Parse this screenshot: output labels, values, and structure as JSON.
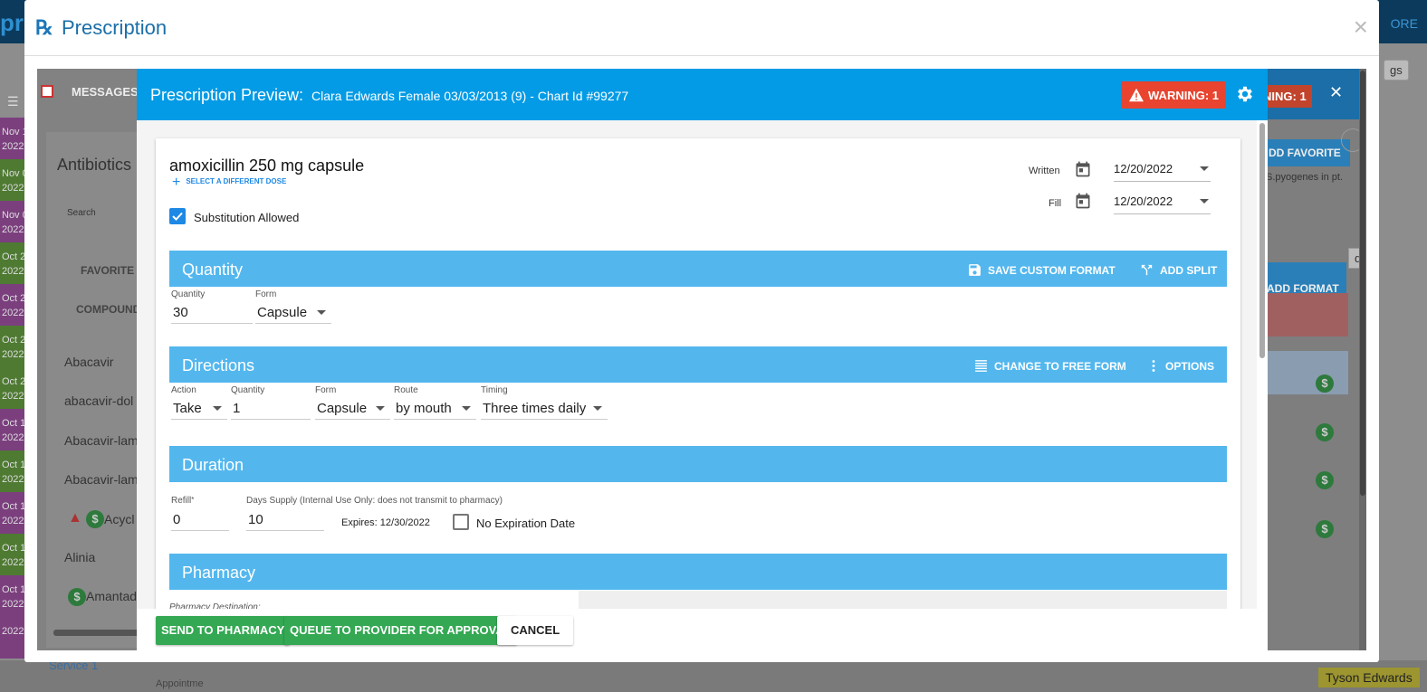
{
  "background": {
    "logo": "pr",
    "more": "ORE",
    "messages": "MESSAGES",
    "antibiotics": "Antibiotics",
    "search": "Search",
    "favorite": "FAVORITE",
    "compound": "COMPOUND",
    "items": [
      "Abacavir",
      "abacavir-dol",
      "Abacavir-lam",
      "Abacavir-lam",
      "Acycl",
      "Alinia",
      "Amantad"
    ],
    "dates": [
      "Nov 1 2022",
      "Nov 0 2022",
      "Nov 0 2022",
      "Oct 2 2022",
      "Oct 2 2022",
      "Oct 2 2022",
      "Oct 2 2022",
      "Oct 1 2022",
      "Oct 1 2022",
      "Oct 1 2022",
      "Oct 1 2022",
      "Oct 1 2022",
      "2022"
    ],
    "warning": "NING: 1",
    "add_favorite": "DD FAVORITE",
    "pyogenes": "S.pyogenes in pt.",
    "add_format": "ADD FORMAT",
    "ngs": "gs",
    "d": "d",
    "service": "Service 1",
    "appointment": "Appointme",
    "user": "Tyson Edwards",
    "dollar": "$"
  },
  "outer": {
    "rx": "℞",
    "title": "Prescription",
    "close": "×"
  },
  "preview": {
    "title": "Prescription Preview:",
    "patient": "Clara Edwards Female 03/03/2013 (9) - Chart Id #99277",
    "warning": "WARNING: 1",
    "close": "✕"
  },
  "drug": {
    "name": "amoxicillin 250 mg capsule",
    "select_dose": "SELECT A DIFFERENT DOSE",
    "substitution_label": "Substitution Allowed",
    "written_label": "Written",
    "written_value": "12/20/2022",
    "fill_label": "Fill",
    "fill_value": "12/20/2022"
  },
  "quantity": {
    "title": "Quantity",
    "save_custom": "SAVE CUSTOM FORMAT",
    "add_split": "ADD SPLIT",
    "qty_label": "Quantity",
    "qty_value": "30",
    "form_label": "Form",
    "form_value": "Capsule"
  },
  "directions": {
    "title": "Directions",
    "free_form": "CHANGE TO FREE FORM",
    "options": "OPTIONS",
    "action_label": "Action",
    "action_value": "Take",
    "qty_label": "Quantity",
    "qty_value": "1",
    "form_label": "Form",
    "form_value": "Capsule",
    "route_label": "Route",
    "route_value": "by mouth",
    "timing_label": "Timing",
    "timing_value": "Three times daily"
  },
  "duration": {
    "title": "Duration",
    "refill_label": "Refill",
    "refill_req": "*",
    "refill_value": "0",
    "days_label": "Days Supply (Internal Use Only: does not transmit to pharmacy)",
    "days_value": "10",
    "expires": "Expires: 12/30/2022",
    "no_expiration": "No Expiration Date"
  },
  "pharmacy": {
    "title": "Pharmacy",
    "destination": "Pharmacy Destination:"
  },
  "footer": {
    "send": "SEND TO PHARMACY",
    "queue": "QUEUE TO PROVIDER FOR APPROVAL",
    "cancel": "CANCEL"
  }
}
